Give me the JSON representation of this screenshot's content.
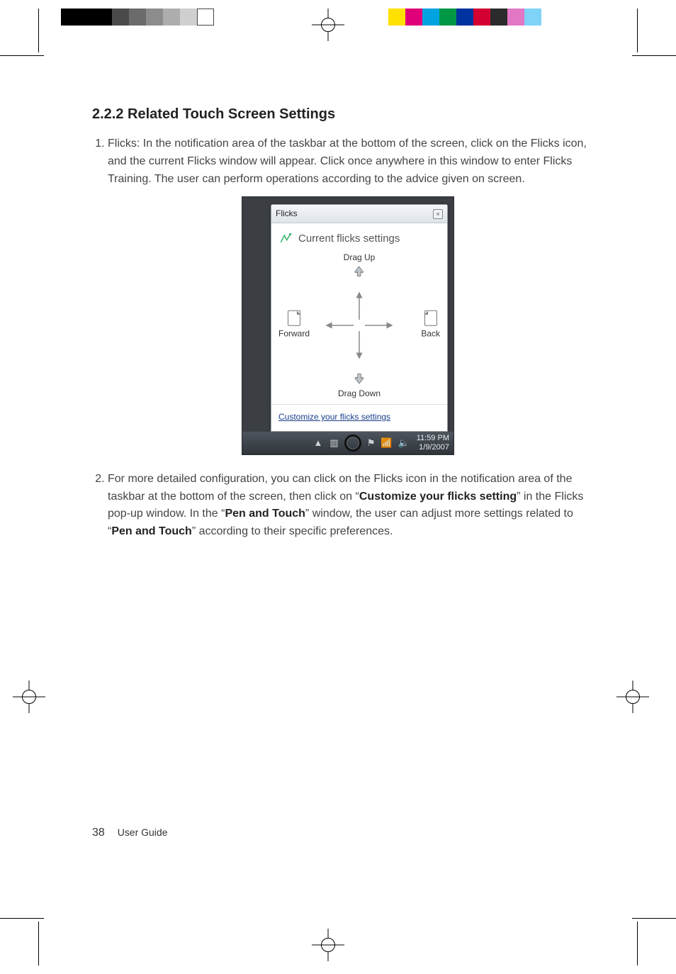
{
  "section": {
    "number": "2.2.2",
    "title": "Related Touch Screen Settings"
  },
  "items": {
    "one": {
      "num": "1.",
      "text": "Flicks: In the notification area of the taskbar at the bottom of the screen, click on the Flicks icon, and the current Flicks window will appear. Click once anywhere in this window to enter Flicks Training. The user can perform operations according to the advice given on screen."
    },
    "two": {
      "num": "2.",
      "pre": "For more detailed configuration, you can click on the Flicks icon in the notification area of the taskbar at the bottom of the screen, then click on “",
      "b1": "Customize your flicks setting",
      "mid1": "” in the Flicks pop-up window. In the “",
      "b2": "Pen and Touch",
      "mid2": "” window, the user can adjust more settings related to “",
      "b3": "Pen and Touch",
      "post": "” according to their specific preferences."
    }
  },
  "shot": {
    "window_title": "Flicks",
    "heading": "Current flicks settings",
    "up": "Drag Up",
    "down": "Drag Down",
    "left": "Forward",
    "right": "Back",
    "link": "Customize your flicks settings",
    "time": "11:59 PM",
    "date": "1/9/2007"
  },
  "footer": {
    "page": "38",
    "label": "User Guide"
  }
}
